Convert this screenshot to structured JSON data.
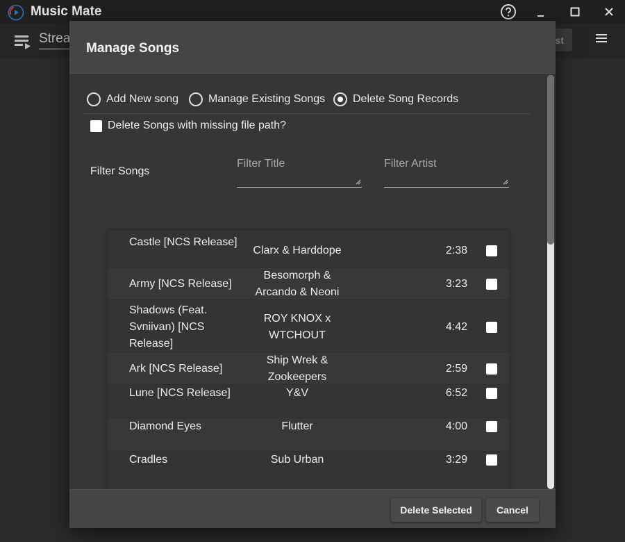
{
  "window": {
    "title": "Music Mate",
    "logo_icon": "music-disc-logo",
    "controls": [
      "help-icon",
      "minimize-icon",
      "maximize-icon",
      "close-icon"
    ]
  },
  "background": {
    "stream_label": "Strea",
    "button_label": "st"
  },
  "dialog": {
    "title": "Manage Songs",
    "modes": [
      {
        "label": "Add New song",
        "selected": false
      },
      {
        "label": "Manage Existing Songs",
        "selected": false
      },
      {
        "label": "Delete Song Records",
        "selected": true
      }
    ],
    "missing_path_label": "Delete Songs with missing file path?",
    "missing_path_checked": false,
    "filter": {
      "label": "Filter Songs",
      "title_placeholder": "Filter Title",
      "artist_placeholder": "Filter Artist"
    },
    "songs": [
      {
        "title": "Castle [NCS Release]",
        "artist": "Clarx & Harddope",
        "duration": "2:38",
        "selected": false
      },
      {
        "title": "Army [NCS Release]",
        "artist": "Besomorph & Arcando & Neoni",
        "duration": "3:23",
        "selected": false
      },
      {
        "title": "Shadows (Feat. Svniivan) [NCS Release]",
        "artist": "ROY KNOX x WTCHOUT",
        "duration": "4:42",
        "selected": false
      },
      {
        "title": "Ark [NCS Release]",
        "artist": "Ship Wrek & Zookeepers",
        "duration": "2:59",
        "selected": false
      },
      {
        "title": "Lune [NCS Release]",
        "artist": "Y&V",
        "duration": "6:52",
        "selected": false
      },
      {
        "title": "Diamond Eyes",
        "artist": "Flutter",
        "duration": "4:00",
        "selected": false
      },
      {
        "title": "Cradles",
        "artist": "Sub Urban",
        "duration": "3:29",
        "selected": false
      }
    ],
    "buttons": {
      "delete_selected": "Delete Selected",
      "cancel": "Cancel"
    }
  },
  "colors": {
    "dialog_bg": "#363636",
    "header_bg": "#454545",
    "app_bg": "#2b2b2b",
    "text": "#ececec"
  }
}
